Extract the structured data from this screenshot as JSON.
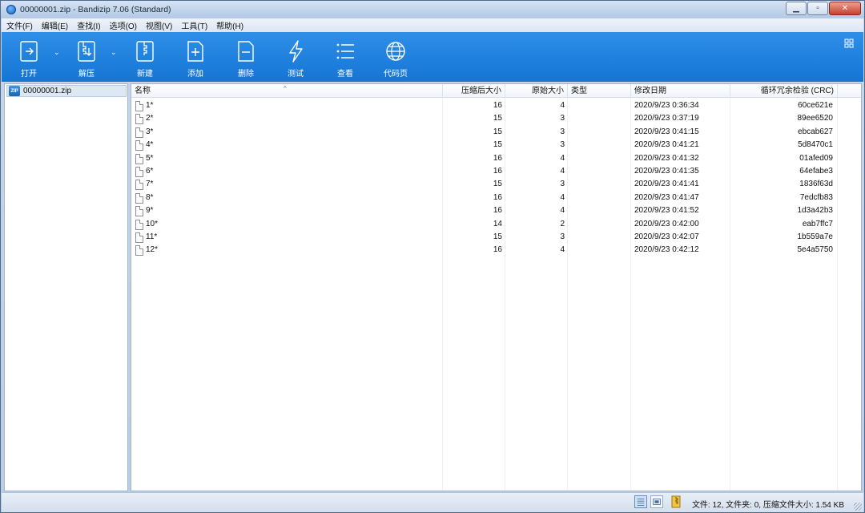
{
  "window": {
    "title": "00000001.zip - Bandizip 7.06 (Standard)"
  },
  "menu": [
    "文件(F)",
    "编辑(E)",
    "查找(I)",
    "选项(O)",
    "视图(V)",
    "工具(T)",
    "帮助(H)"
  ],
  "toolbar": {
    "open": "打开",
    "extract": "解压",
    "new": "新建",
    "add": "添加",
    "delete": "删除",
    "test": "测试",
    "view": "查看",
    "codepage": "代码页"
  },
  "tree": {
    "archive": "00000001.zip"
  },
  "columns": {
    "name": "名称",
    "packed": "压缩后大小",
    "size": "原始大小",
    "type": "类型",
    "modified": "修改日期",
    "crc": "循环冗余检验 (CRC)"
  },
  "files": [
    {
      "name": "1*",
      "packed": "16",
      "size": "4",
      "type": "",
      "modified": "2020/9/23 0:36:34",
      "crc": "60ce621e"
    },
    {
      "name": "2*",
      "packed": "15",
      "size": "3",
      "type": "",
      "modified": "2020/9/23 0:37:19",
      "crc": "89ee6520"
    },
    {
      "name": "3*",
      "packed": "15",
      "size": "3",
      "type": "",
      "modified": "2020/9/23 0:41:15",
      "crc": "ebcab627"
    },
    {
      "name": "4*",
      "packed": "15",
      "size": "3",
      "type": "",
      "modified": "2020/9/23 0:41:21",
      "crc": "5d8470c1"
    },
    {
      "name": "5*",
      "packed": "16",
      "size": "4",
      "type": "",
      "modified": "2020/9/23 0:41:32",
      "crc": "01afed09"
    },
    {
      "name": "6*",
      "packed": "16",
      "size": "4",
      "type": "",
      "modified": "2020/9/23 0:41:35",
      "crc": "64efabe3"
    },
    {
      "name": "7*",
      "packed": "15",
      "size": "3",
      "type": "",
      "modified": "2020/9/23 0:41:41",
      "crc": "1836f63d"
    },
    {
      "name": "8*",
      "packed": "16",
      "size": "4",
      "type": "",
      "modified": "2020/9/23 0:41:47",
      "crc": "7edcfb83"
    },
    {
      "name": "9*",
      "packed": "16",
      "size": "4",
      "type": "",
      "modified": "2020/9/23 0:41:52",
      "crc": "1d3a42b3"
    },
    {
      "name": "10*",
      "packed": "14",
      "size": "2",
      "type": "",
      "modified": "2020/9/23 0:42:00",
      "crc": "eab7ffc7"
    },
    {
      "name": "11*",
      "packed": "15",
      "size": "3",
      "type": "",
      "modified": "2020/9/23 0:42:07",
      "crc": "1b559a7e"
    },
    {
      "name": "12*",
      "packed": "16",
      "size": "4",
      "type": "",
      "modified": "2020/9/23 0:42:12",
      "crc": "5e4a5750"
    }
  ],
  "status": {
    "summary": "文件: 12, 文件夹: 0, 压缩文件大小: 1.54 KB"
  },
  "colors": {
    "toolbar": "#1e7fdc",
    "title_bar": "#bfd2ea",
    "selection": "#dde8f4"
  }
}
